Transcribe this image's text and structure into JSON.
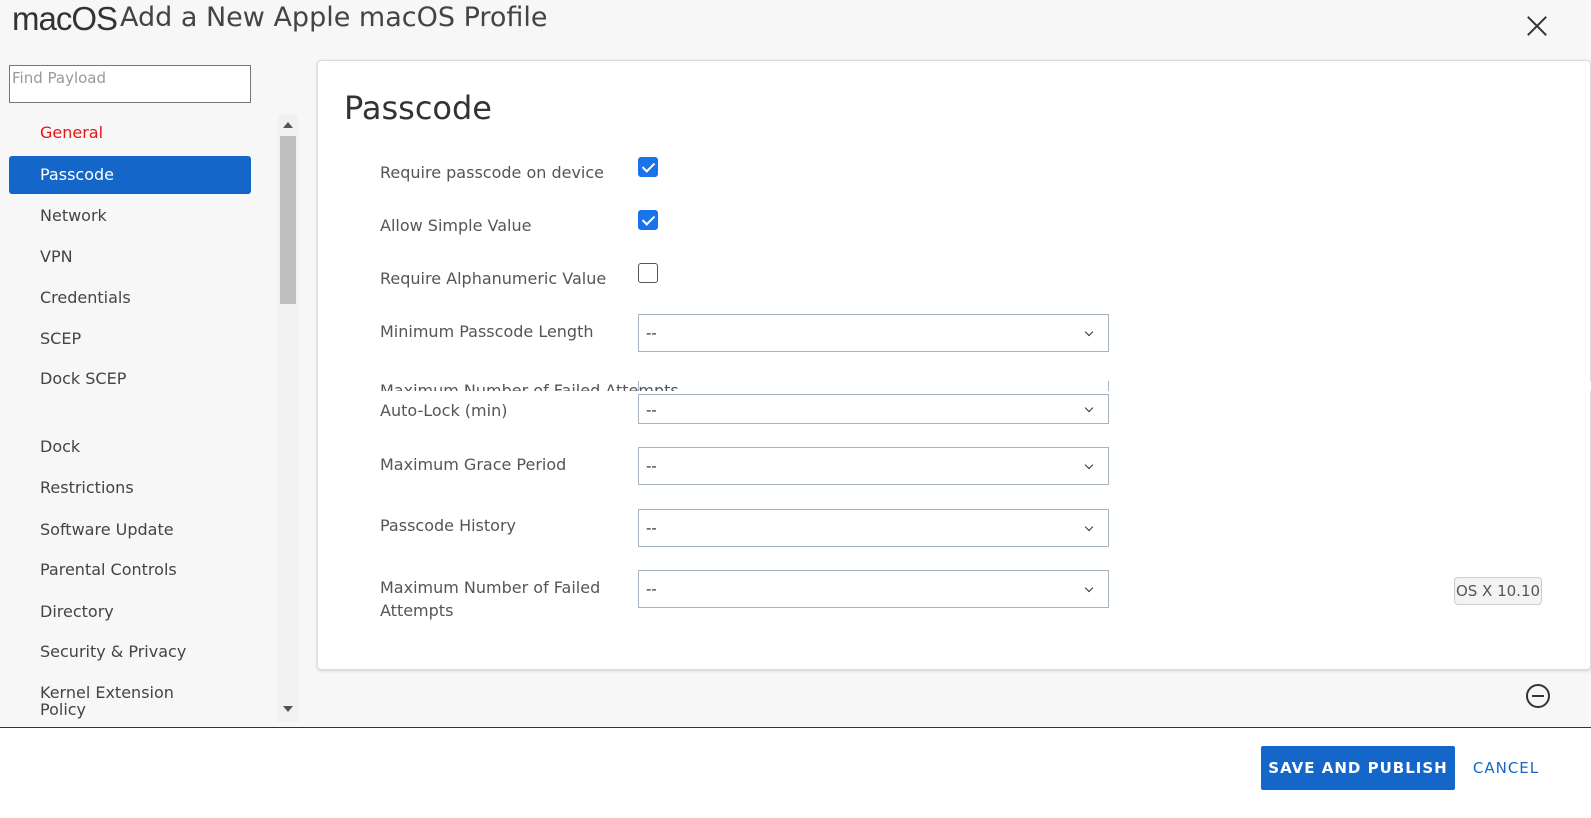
{
  "header": {
    "brand": "macOS",
    "title": "Add a New Apple macOS Profile"
  },
  "sidebar": {
    "search_placeholder": "Find Payload",
    "items": [
      {
        "label": "General"
      },
      {
        "label": "Passcode"
      },
      {
        "label": "Network"
      },
      {
        "label": "VPN"
      },
      {
        "label": "Credentials"
      },
      {
        "label": "SCEP"
      },
      {
        "label": "Dock SCEP"
      },
      {
        "label": "Dock"
      },
      {
        "label": "Restrictions"
      },
      {
        "label": "Software Update"
      },
      {
        "label": "Parental Controls"
      },
      {
        "label": "Directory"
      },
      {
        "label": "Security & Privacy"
      },
      {
        "label": "Kernel Extension Policy"
      }
    ]
  },
  "panel": {
    "title": "Passcode",
    "fields": {
      "require_passcode": {
        "label": "Require passcode on device",
        "checked": true
      },
      "allow_simple": {
        "label": "Allow Simple Value",
        "checked": true
      },
      "require_alphanumeric": {
        "label": "Require Alphanumeric Value",
        "checked": false
      },
      "min_length": {
        "label": "Minimum Passcode Length",
        "value": "--"
      },
      "auto_lock": {
        "label": "Auto-Lock (min)",
        "value": "--"
      },
      "grace_period": {
        "label": "Maximum Grace Period",
        "value": "--"
      },
      "history": {
        "label": "Passcode History",
        "value": "--"
      },
      "failed_attempts": {
        "label": "Maximum Number of Failed Attempts",
        "value": "--"
      }
    },
    "os_badge": "OS X 10.10"
  },
  "footer": {
    "save_label": "SAVE AND PUBLISH",
    "cancel_label": "CANCEL"
  },
  "colors": {
    "accent": "#1467c8",
    "general_red": "#e41414",
    "checkbox_blue": "#1a73e8"
  }
}
